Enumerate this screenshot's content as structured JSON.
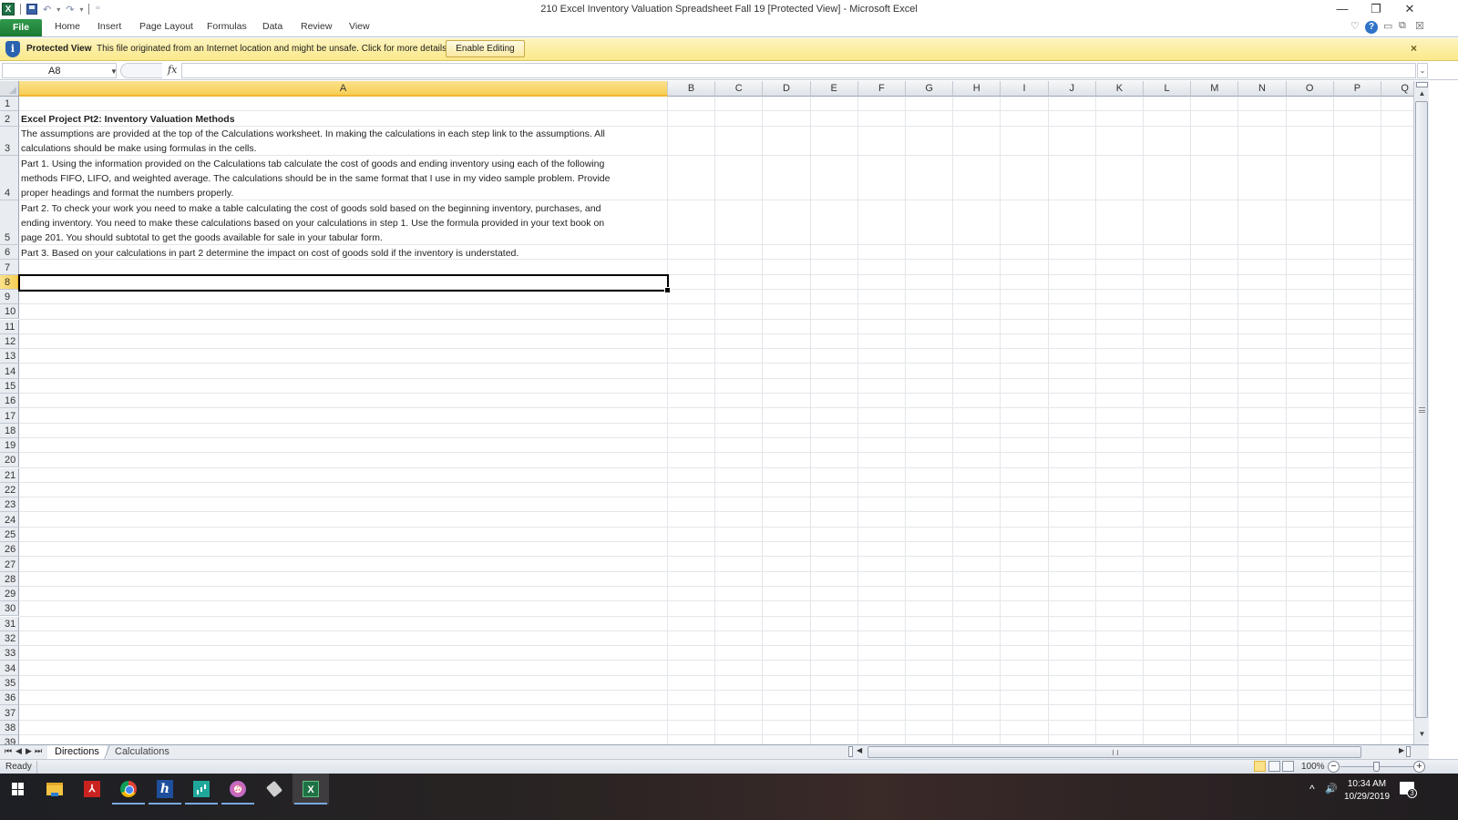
{
  "window": {
    "title": "210 Excel Inventory Valuation Spreadsheet Fall 19  [Protected View]  -  Microsoft Excel",
    "controls": {
      "minimize": "—",
      "restore": "❐",
      "close": "✕"
    }
  },
  "quick_access": {
    "app_icon": "X",
    "save": "save-icon",
    "undo": "↶",
    "redo": "↷",
    "customize": "⁼"
  },
  "ribbon": {
    "file_label": "File",
    "tabs": [
      "Home",
      "Insert",
      "Page Layout",
      "Formulas",
      "Data",
      "Review",
      "View"
    ],
    "right_icons": {
      "minimize_ribbon": "♡",
      "help": "?",
      "doc_minimize": "▭",
      "doc_restore": "⧉",
      "doc_close": "☒"
    }
  },
  "protected_view": {
    "icon": "i",
    "label": "Protected View",
    "message": "This file originated from an Internet location and might be unsafe. Click for more details.",
    "button_label": "Enable Editing",
    "close": "×"
  },
  "formula_bar": {
    "name_box": "A8",
    "fx_label": "fx",
    "formula": ""
  },
  "sheet": {
    "columns": [
      "A",
      "B",
      "C",
      "D",
      "E",
      "F",
      "G",
      "H",
      "I",
      "J",
      "K",
      "L",
      "M",
      "N",
      "O",
      "P",
      "Q"
    ],
    "selected_column": "A",
    "selected_row": 8,
    "active_cell": "A8",
    "row_numbers": [
      "1",
      "2",
      "3",
      "4",
      "5",
      "6",
      "7",
      "8",
      "9",
      "10",
      "11",
      "12",
      "13",
      "14",
      "15",
      "16",
      "17",
      "18",
      "19",
      "20",
      "21",
      "22",
      "23",
      "24",
      "25",
      "26",
      "27",
      "28",
      "29",
      "30",
      "31",
      "32",
      "33",
      "34",
      "35",
      "36",
      "37",
      "38",
      "39"
    ],
    "cells": {
      "A2": "Excel Project Pt2: Inventory Valuation Methods",
      "A3": [
        "The assumptions are provided at the top of the Calculations worksheet. In making the calculations in each step link to the assumptions. All",
        "calculations should be make using formulas in the cells."
      ],
      "A4": [
        "Part 1. Using the information provided on the Calculations tab calculate the cost of goods and ending inventory using each of the following",
        "methods FIFO, LIFO, and weighted average. The calculations should be in the same format that I use in my video sample problem. Provide",
        "proper headings and format the numbers properly."
      ],
      "A5": [
        "Part 2. To check your work you need to make a table calculating the cost of goods sold based on the beginning inventory, purchases, and",
        "ending inventory. You need to make these calculations based on your calculations in step 1. Use the formula provided in your text book on",
        "page 201. You should subtotal to get the goods available for sale in your tabular form."
      ],
      "A6": "Part 3. Based on your calculations in part 2 determine the impact on cost of goods sold if the inventory is understated."
    }
  },
  "sheet_tabs": {
    "nav": [
      "⏮",
      "◀",
      "▶",
      "⏭"
    ],
    "tabs": [
      {
        "label": "Directions",
        "active": true
      },
      {
        "label": "Calculations",
        "active": false
      }
    ]
  },
  "status_bar": {
    "status": "Ready",
    "zoom": "100%",
    "zoom_minus": "−",
    "zoom_plus": "+"
  },
  "taskbar": {
    "apps": [
      "start",
      "file-explorer",
      "adobe-acrobat",
      "chrome",
      "h-app",
      "chart-app",
      "itunes",
      "tag-app",
      "excel"
    ],
    "tray": {
      "chevron": "^",
      "volume": "🔊"
    },
    "time": "10:34 AM",
    "date": "10/29/2019",
    "notification_count": "3"
  }
}
